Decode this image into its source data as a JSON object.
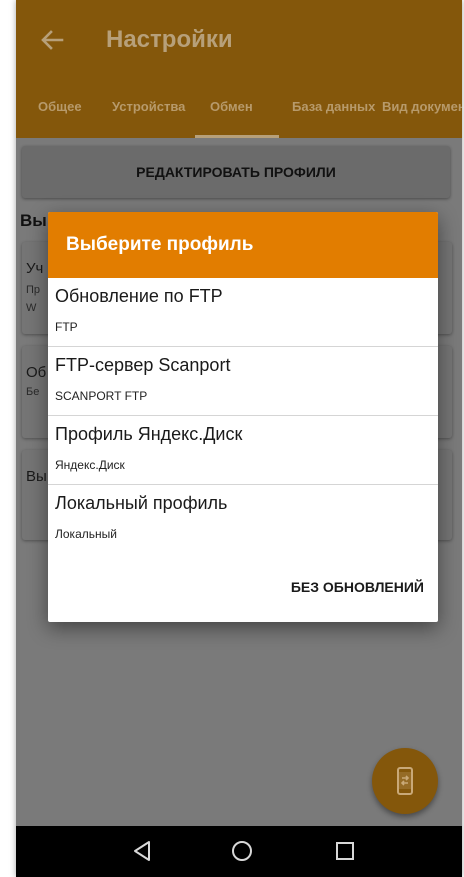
{
  "appbar": {
    "title": "Настройки"
  },
  "tabs": [
    {
      "label": "Общее",
      "selected": false
    },
    {
      "label": "Устройства",
      "selected": false
    },
    {
      "label": "Обмен",
      "selected": true
    },
    {
      "label": "База данных",
      "selected": false
    },
    {
      "label": "Вид документа",
      "selected": false
    }
  ],
  "content": {
    "edit_profiles_label": "РЕДАКТИРОВАТЬ ПРОФИЛИ",
    "section_heading": "Вы",
    "cards": [
      {
        "title": "Уч",
        "lines": [
          "Пр",
          "W"
        ]
      },
      {
        "title": "Об",
        "lines": [
          "Бе"
        ]
      },
      {
        "title": "Вы",
        "lines": []
      }
    ]
  },
  "dialog": {
    "title": "Выберите профиль",
    "options": [
      {
        "title": "Обновление по FTP",
        "subtitle": "FTP"
      },
      {
        "title": "FTP-сервер Scanport",
        "subtitle": "SCANPORT FTP"
      },
      {
        "title": "Профиль Яндекс.Диск",
        "subtitle": "Яндекс.Диск"
      },
      {
        "title": "Локальный профиль",
        "subtitle": "Локальный"
      }
    ],
    "action_label": "БЕЗ ОБНОВЛЕНИЙ"
  },
  "fab": {
    "icon": "phone-sync-icon"
  },
  "navbar": {
    "icons": [
      "back-triangle-icon",
      "home-circle-icon",
      "recents-square-icon"
    ]
  },
  "colors": {
    "accent": "#e27d00",
    "accent_dimmed": "#84570b",
    "scrim_background": "#7a7a7a",
    "navbar": "#000000"
  }
}
